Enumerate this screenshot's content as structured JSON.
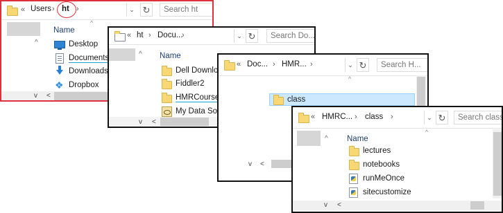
{
  "window1": {
    "breadcrumb": [
      "Users",
      "ht"
    ],
    "overflow": "«",
    "search_placeholder": "Search ht",
    "column": "Name",
    "items": [
      "Desktop",
      "Documents",
      "Downloads",
      "Dropbox"
    ],
    "border_color": "#e0303a"
  },
  "window2": {
    "breadcrumb": [
      "ht",
      "Docu..."
    ],
    "overflow": "«",
    "search_placeholder": "Search Do...",
    "column": "Name",
    "items": [
      "Dell Downloa",
      "Fiddler2",
      "HMRCourse",
      "My Data Sou"
    ]
  },
  "window3": {
    "breadcrumb": [
      "Doc...",
      "HMR..."
    ],
    "overflow": "«",
    "search_placeholder": "Search H...",
    "items": [
      "class"
    ]
  },
  "window4": {
    "breadcrumb": [
      "HMRC...",
      "class"
    ],
    "overflow": "«",
    "search_placeholder": "Search class",
    "column": "Name",
    "items": [
      "lectures",
      "notebooks",
      "runMeOnce",
      "sitecustomize"
    ]
  },
  "glyphs": {
    "sep": "›",
    "chevron_down": "⌄",
    "refresh": "↻",
    "up": "^",
    "scroll_left": "<",
    "scroll_up": "^",
    "scroll_down": "v",
    "sort_up": "^"
  }
}
